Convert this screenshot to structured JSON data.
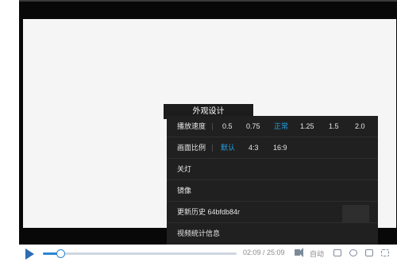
{
  "menu": {
    "tooltip": "外观设计",
    "rows": [
      {
        "label": "播放速度",
        "options": [
          "0.5",
          "0.75",
          "正常",
          "1.25",
          "1.5",
          "2.0"
        ],
        "active": "正常"
      },
      {
        "label": "画面比例",
        "options": [
          "默认",
          "4:3",
          "16:9"
        ],
        "active": "默认"
      },
      {
        "label": "关灯"
      },
      {
        "label": "镜像"
      },
      {
        "label": "更新历史 64bfdb84r"
      },
      {
        "label": "视频统计信息"
      }
    ]
  },
  "controls": {
    "time": "02:09 / 25:09",
    "quality": "自动",
    "progress": 0.09
  },
  "colors": {
    "accent": "#21a0e3",
    "menu_bg": "#202020"
  },
  "icons": [
    "play-icon",
    "volume-icon",
    "danmaku-icon",
    "loop-icon",
    "tv-icon",
    "fullscreen-icon"
  ]
}
